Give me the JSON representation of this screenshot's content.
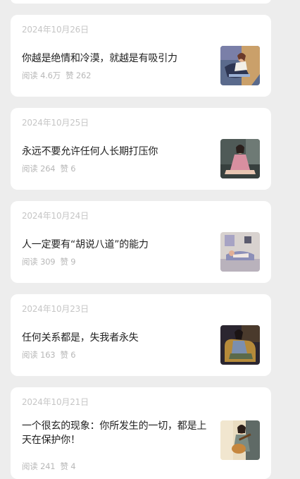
{
  "articles": [
    {
      "date": "2024年10月26日",
      "title": "你越是绝情和冷漠，就越是有吸引力",
      "reads_label": "阅读",
      "reads": "4.6万",
      "likes_label": "赞",
      "likes": "262",
      "thumbnail_icon": "illustration-woman-reclining-on-sofa"
    },
    {
      "date": "2024年10月25日",
      "title": "永远不要允许任何人长期打压你",
      "reads_label": "阅读",
      "reads": "264",
      "likes_label": "赞",
      "likes": "6",
      "thumbnail_icon": "illustration-woman-in-pink-dress-seated"
    },
    {
      "date": "2024年10月24日",
      "title": "人一定要有“胡说八道”的能力",
      "reads_label": "阅读",
      "reads": "309",
      "likes_label": "赞",
      "likes": "9",
      "thumbnail_icon": "illustration-woman-lying-in-room"
    },
    {
      "date": "2024年10月23日",
      "title": "任何关系都是，失我者永失",
      "reads_label": "阅读",
      "reads": "163",
      "likes_label": "赞",
      "likes": "6",
      "thumbnail_icon": "illustration-woman-in-armchair"
    },
    {
      "date": "2024年10月21日",
      "title": "一个很玄的现象：你所发生的一切，都是上天在保护你！",
      "reads_label": "阅读",
      "reads": "241",
      "likes_label": "赞",
      "likes": "4",
      "thumbnail_icon": "illustration-woman-with-guitar"
    }
  ]
}
